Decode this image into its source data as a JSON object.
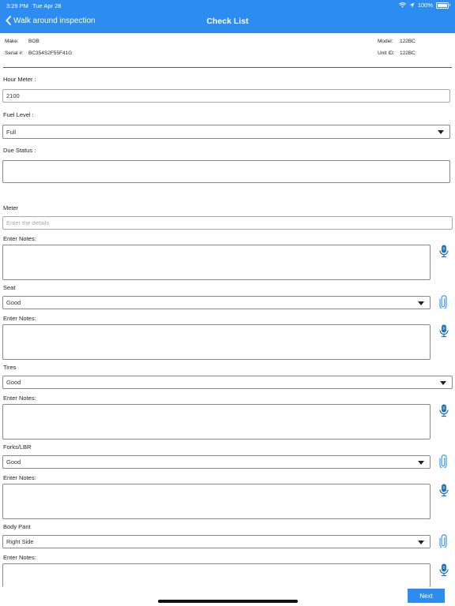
{
  "status": {
    "time": "3:29 PM",
    "date": "Tue Apr 28",
    "battery": "100%"
  },
  "nav": {
    "back_label": "Walk around inspection",
    "title": "Check List"
  },
  "equipment": {
    "make_label": "Make:",
    "make": "BOB",
    "serial_label": "Serial #:",
    "serial": "BC354S2F55F41G",
    "model_label": "Model:",
    "model": "122BC",
    "unit_label": "Unit ID:",
    "unit": "122BC"
  },
  "hour_meter": {
    "label": "Hour Meter :",
    "value": "2100"
  },
  "fuel_level": {
    "label": "Fuel Level :",
    "value": "Full"
  },
  "due_status": {
    "label": "Due Status :",
    "value": ""
  },
  "meter": {
    "label": "Meter",
    "placeholder": "Enter the details"
  },
  "notes_label": "Enter Notes:",
  "items": [
    {
      "label": "Seat",
      "value": "Good"
    },
    {
      "label": "Tires",
      "value": "Good"
    },
    {
      "label": "Forks/LBR",
      "value": "Good"
    },
    {
      "label": "Body Pant",
      "value": "Right Side"
    }
  ],
  "next_label": "Next",
  "colors": {
    "accent": "#2c8cf0",
    "icon": "#1e6fb8"
  }
}
